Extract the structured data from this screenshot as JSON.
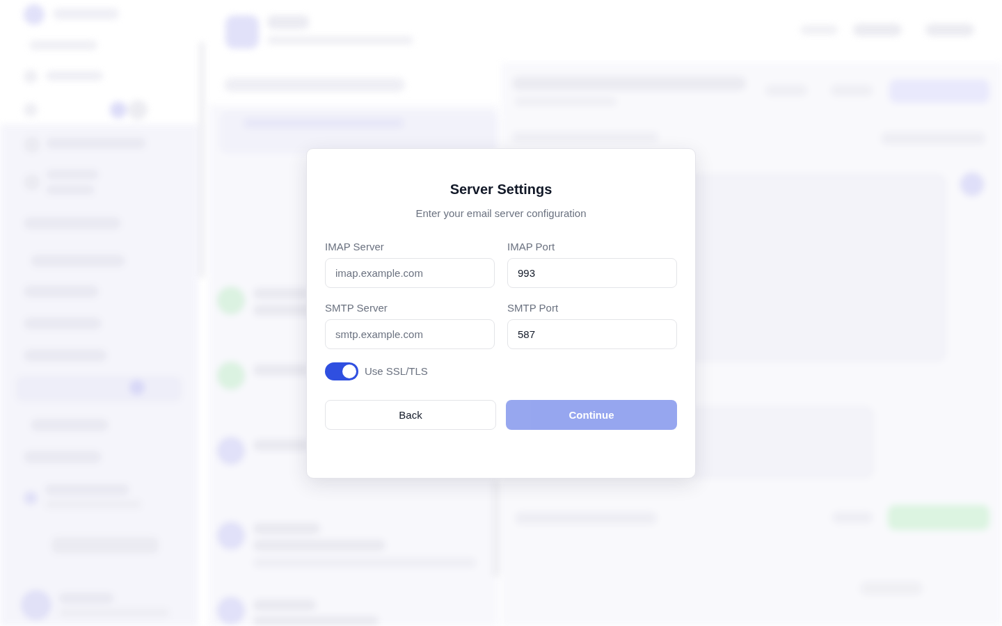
{
  "dialog": {
    "title": "Server Settings",
    "subtitle": "Enter your email server configuration",
    "fields": [
      {
        "label": "IMAP Server",
        "placeholder": "imap.example.com"
      },
      {
        "label": "IMAP Port",
        "value": "993"
      },
      {
        "label": "SMTP Server",
        "placeholder": "smtp.example.com"
      },
      {
        "label": "SMTP Port",
        "value": "587"
      }
    ],
    "ssl_toggle": {
      "label": "Use SSL/TLS",
      "on": true
    },
    "buttons": [
      {
        "label": "Back",
        "kind": "secondary",
        "disabled": false
      },
      {
        "label": "Continue",
        "kind": "primary",
        "disabled": true
      }
    ]
  }
}
